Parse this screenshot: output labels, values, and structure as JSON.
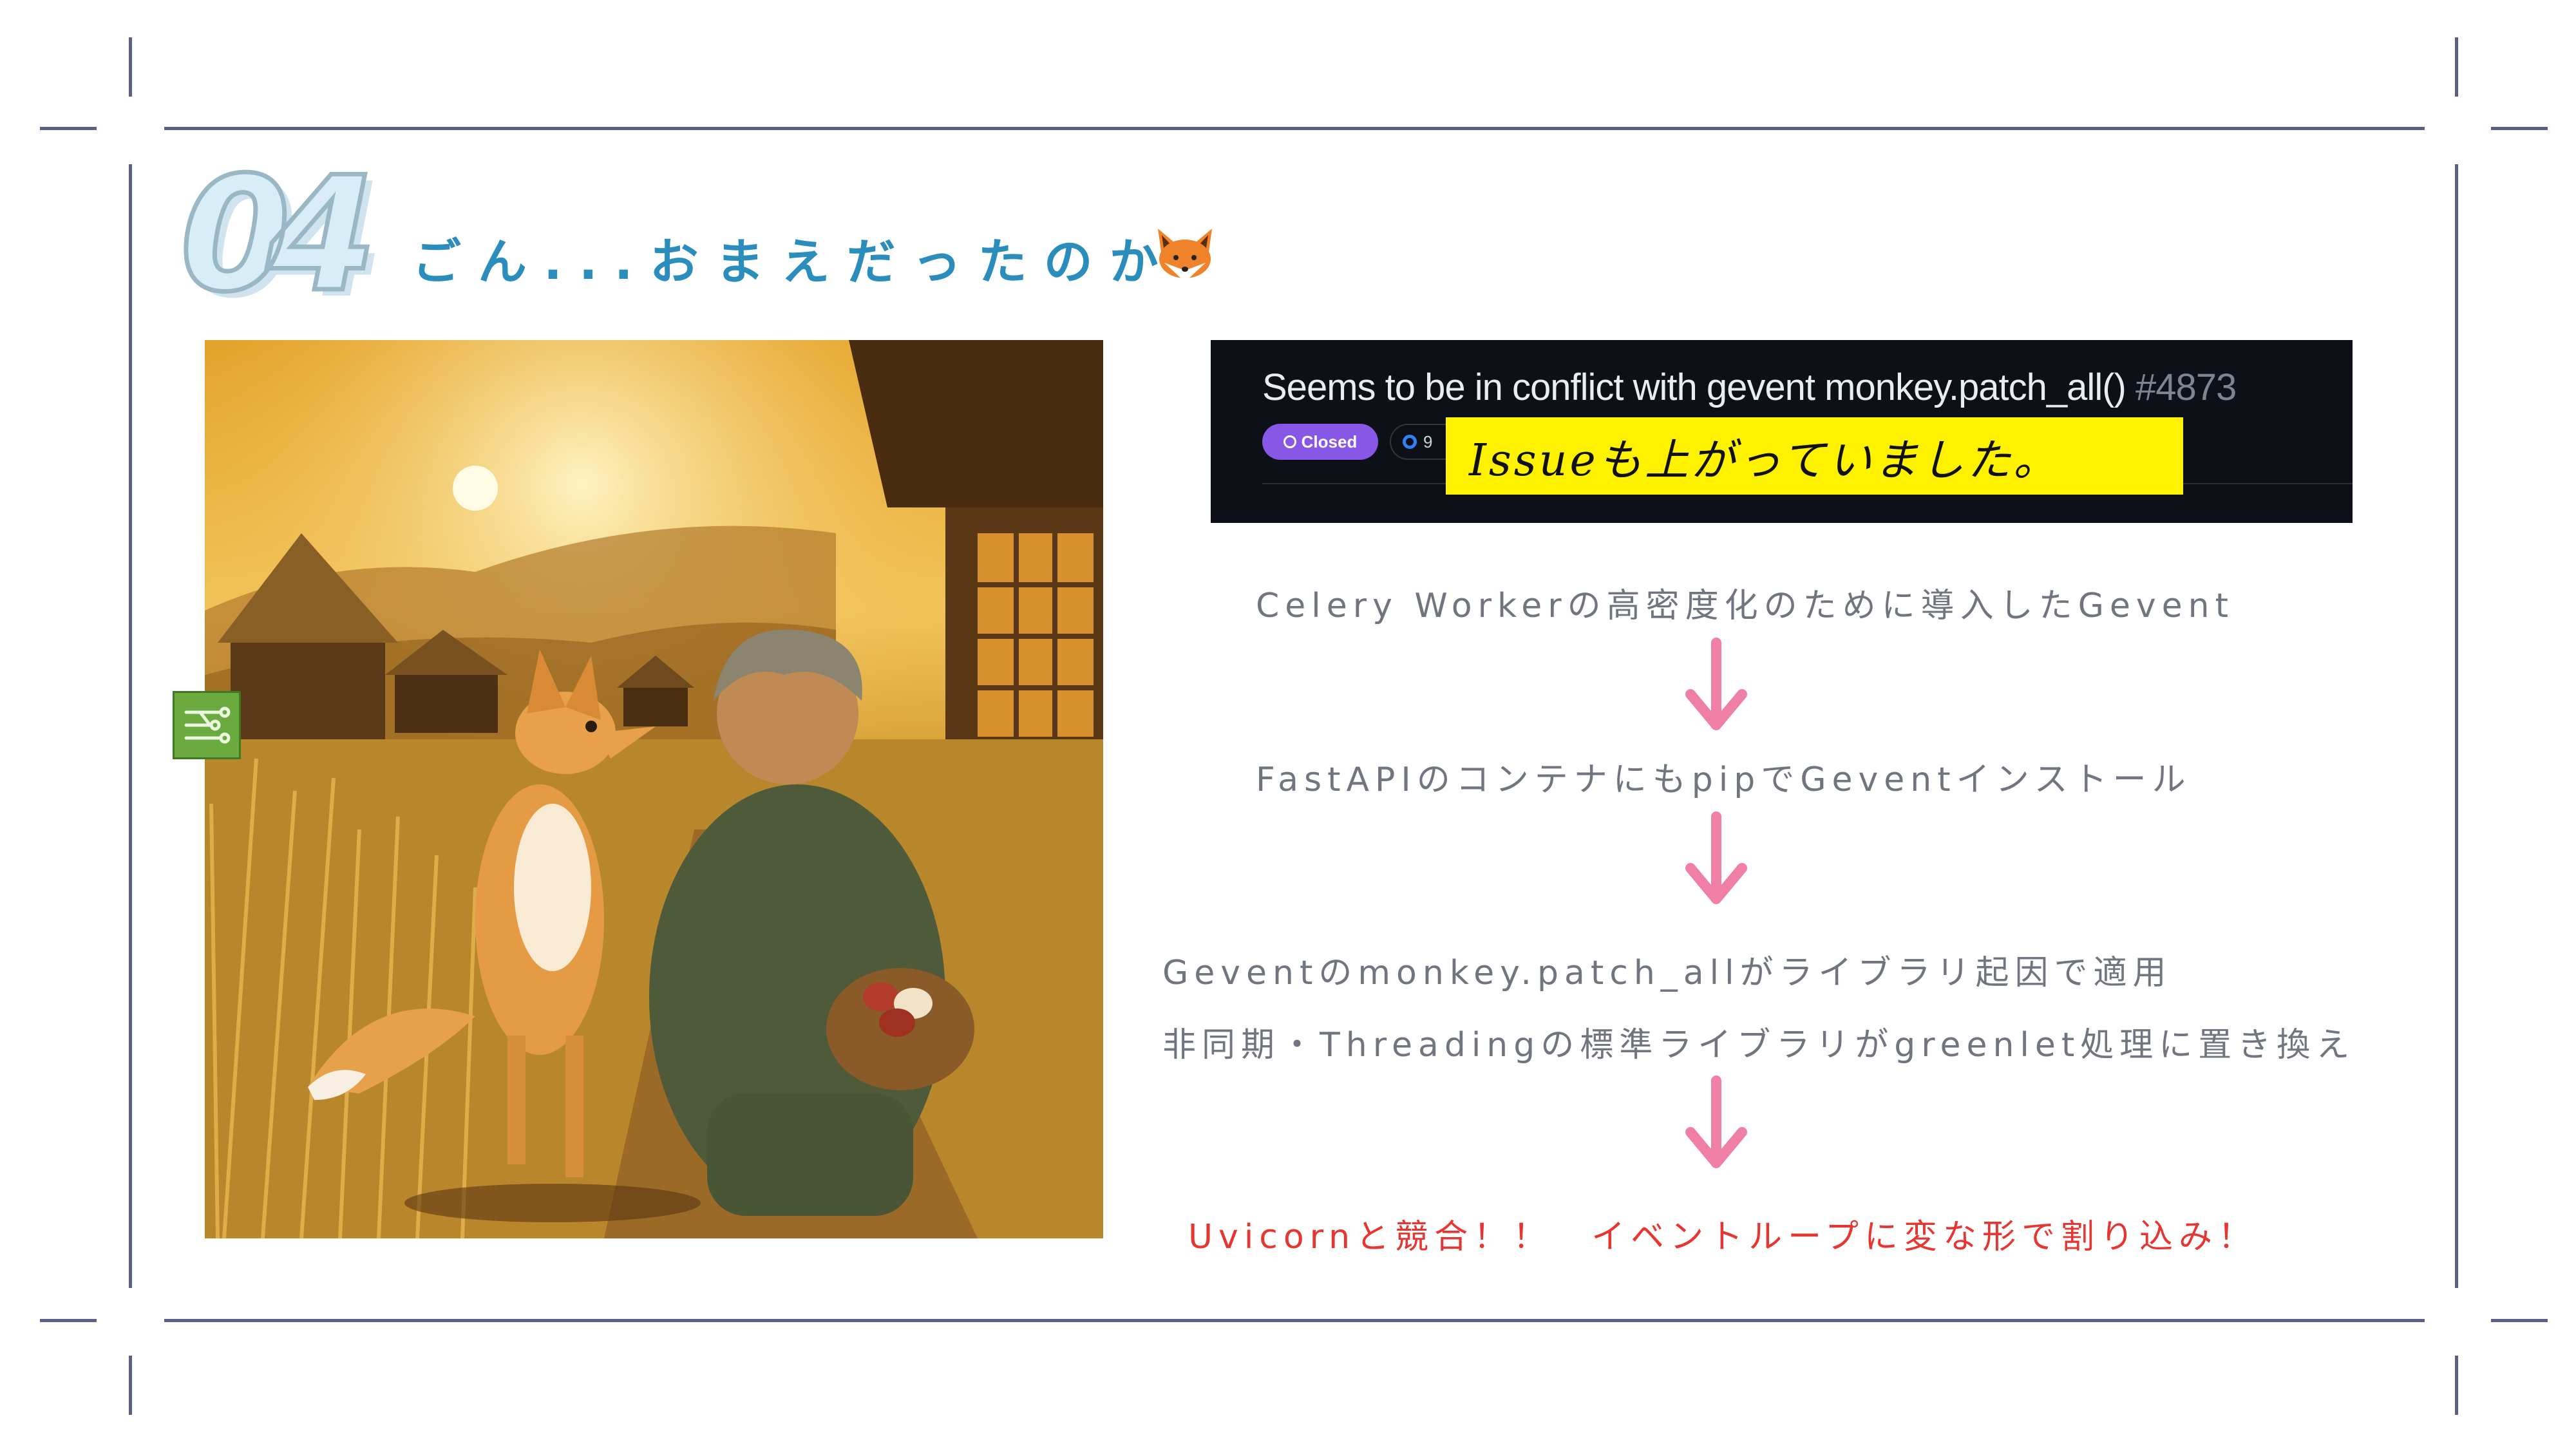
{
  "slide": {
    "number": "04",
    "title": "ごん...おまえだったのか",
    "title_emoji": "fox-face-icon"
  },
  "issue": {
    "title": "Seems to be in conflict with gevent monkey.patch_all()",
    "number": "#4873",
    "status": "Closed",
    "comments": "9",
    "note": "Issueも上がっていました。"
  },
  "flow": {
    "step1": "Celery Workerの高密度化のために導入したGevent",
    "step2": "FastAPIのコンテナにもpipでGeventインストール",
    "step3a": "Geventのmonkey.patch_allがライブラリ起因で適用",
    "step3b": "非同期・Threadingの標準ライブラリがgreenlet処理に置き換え",
    "result": "Uvicornと競合！！　イベントループに変な形で割り込み！"
  },
  "colors": {
    "frame": "#5a5f85",
    "title": "#2a8dbc",
    "arrow": "#f07fa6",
    "result": "#e73631",
    "highlight": "#fff200",
    "issue_bg": "#0d1117",
    "closed_badge": "#8957e5"
  }
}
